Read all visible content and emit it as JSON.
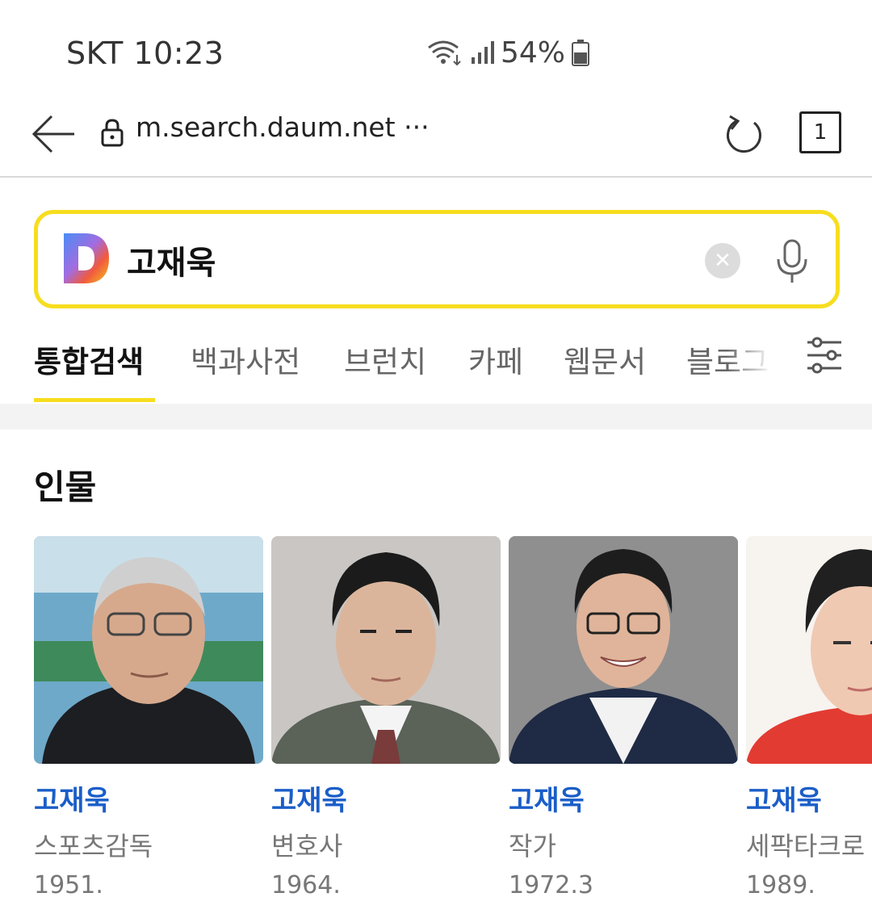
{
  "status_bar": {
    "carrier": "SKT",
    "time": "10:23",
    "battery": "54%"
  },
  "browser": {
    "url": "m.search.daum.net",
    "more_label": "···",
    "tab_count": "1"
  },
  "search": {
    "query": "고재욱"
  },
  "category_tabs": [
    {
      "label": "통합검색",
      "active": true
    },
    {
      "label": "백과사전",
      "active": false
    },
    {
      "label": "브런치",
      "active": false
    },
    {
      "label": "카페",
      "active": false
    },
    {
      "label": "웹문서",
      "active": false
    },
    {
      "label": "블로그",
      "active": false
    }
  ],
  "people_section": {
    "title": "인물",
    "people": [
      {
        "name": "고재욱",
        "job": "스포츠감독",
        "year": "1951."
      },
      {
        "name": "고재욱",
        "job": "변호사",
        "year": "1964."
      },
      {
        "name": "고재욱",
        "job": "작가",
        "year": "1972.3"
      },
      {
        "name": "고재욱",
        "job": "세팍타크로",
        "year": "1989."
      }
    ]
  },
  "colors": {
    "accent_yellow": "#f7dd1f",
    "link_blue": "#1a5ec8"
  }
}
